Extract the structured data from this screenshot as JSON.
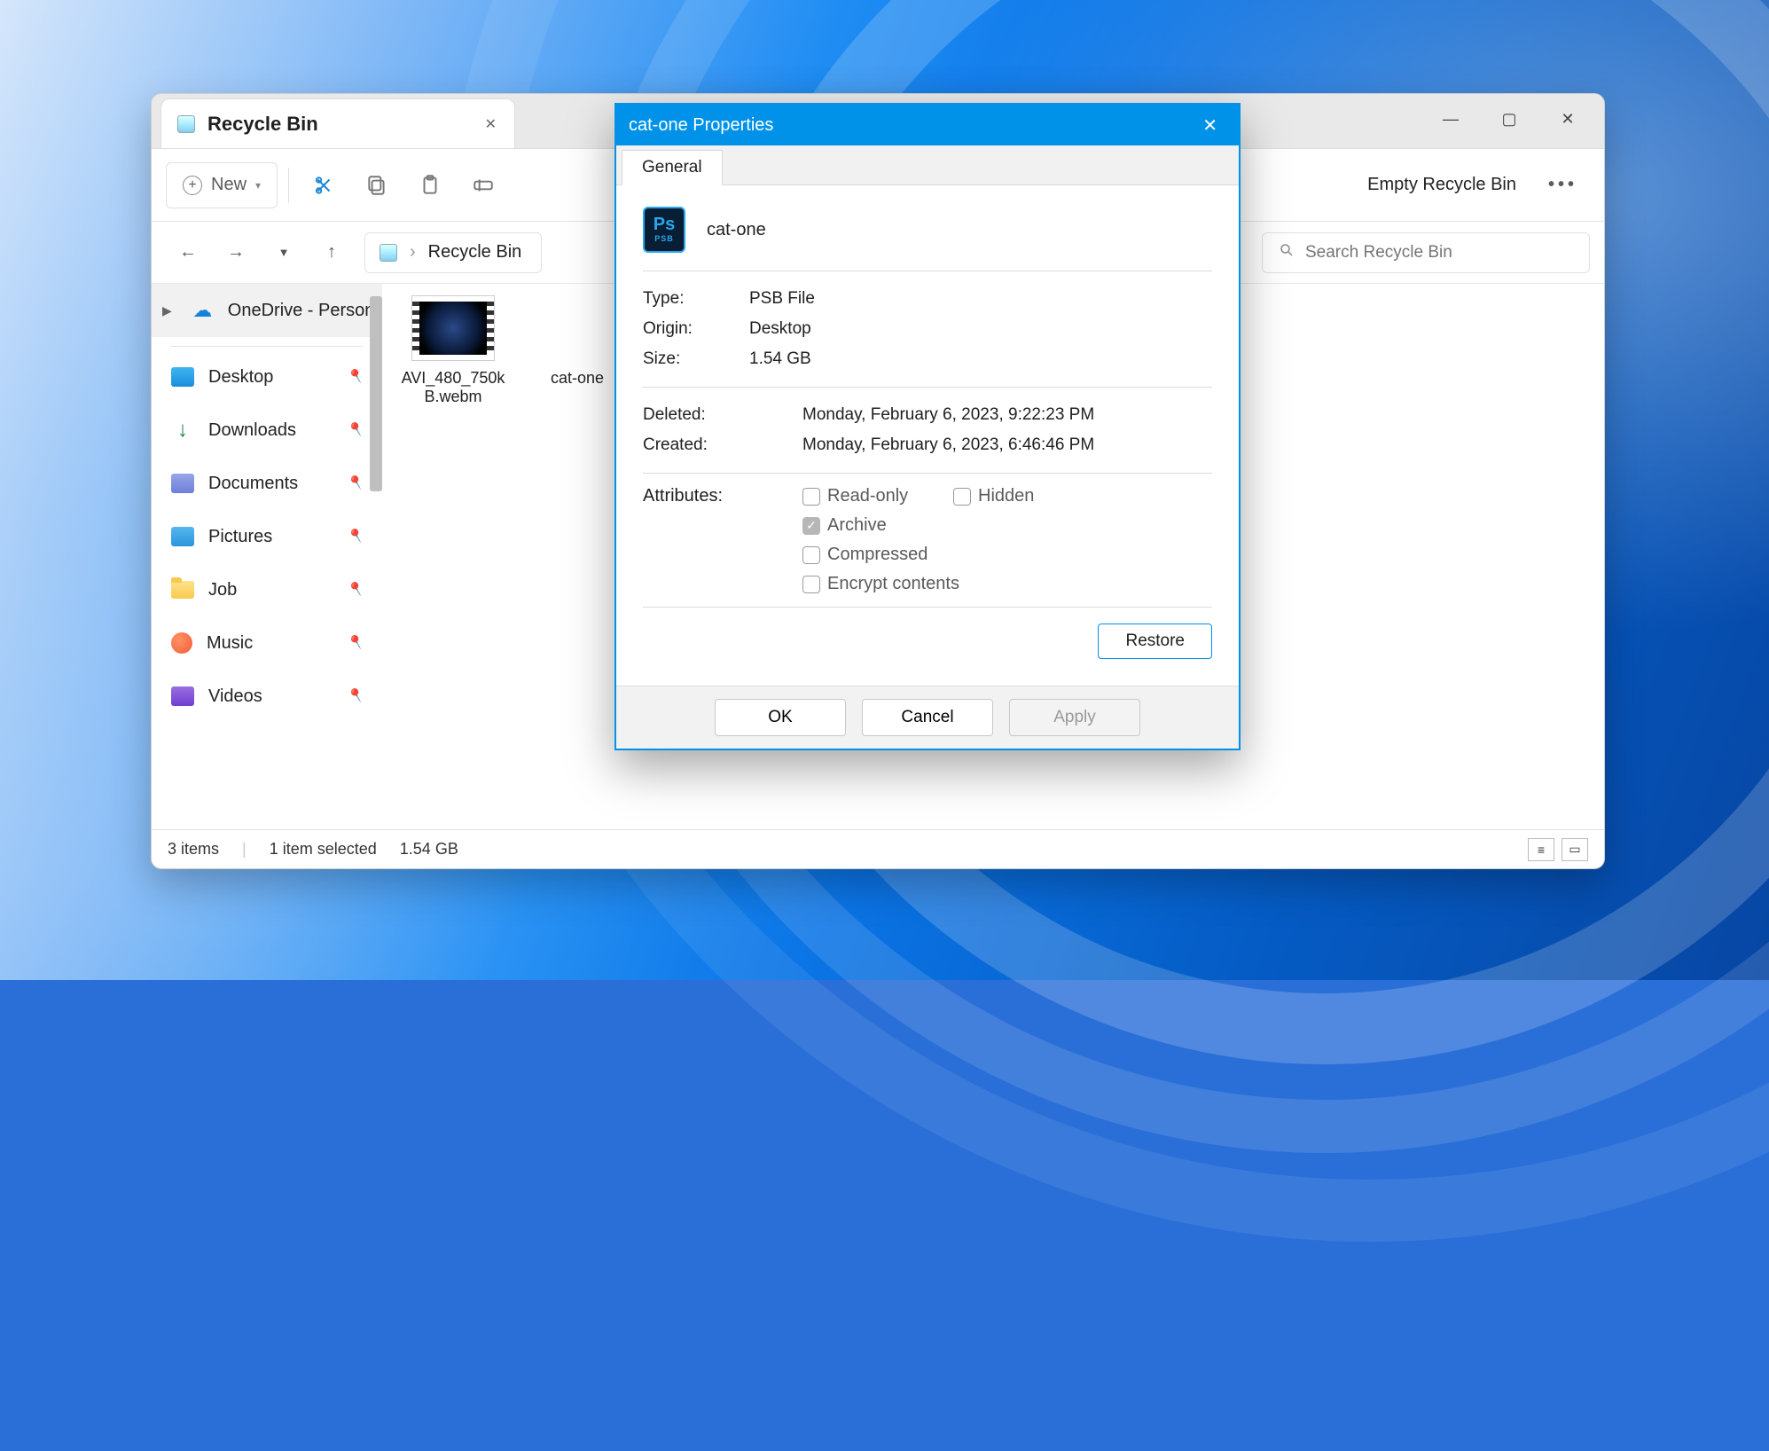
{
  "explorer": {
    "tab_title": "Recycle Bin",
    "toolbar": {
      "new_label": "New",
      "empty_label": "Empty Recycle Bin"
    },
    "breadcrumb": "Recycle Bin",
    "search_placeholder": "Search Recycle Bin",
    "sidebar": {
      "onedrive": "OneDrive - Personal",
      "items": [
        "Desktop",
        "Downloads",
        "Documents",
        "Pictures",
        "Job",
        "Music",
        "Videos"
      ]
    },
    "files": [
      {
        "name": "AVI_480_750kB.webm"
      },
      {
        "name": "cat-one"
      }
    ],
    "status": {
      "count": "3 items",
      "selected": "1 item selected",
      "size": "1.54 GB"
    }
  },
  "props": {
    "title": "cat-one Properties",
    "tab": "General",
    "filename": "cat-one",
    "icon_label_top": "Ps",
    "icon_label_bottom": "PSB",
    "rows1": {
      "type_label": "Type:",
      "type_value": "PSB File",
      "origin_label": "Origin:",
      "origin_value": "Desktop",
      "size_label": "Size:",
      "size_value": "1.54 GB"
    },
    "rows2": {
      "deleted_label": "Deleted:",
      "deleted_value": "Monday, February 6, 2023, 9:22:23 PM",
      "created_label": "Created:",
      "created_value": "Monday, February 6, 2023, 6:46:46 PM"
    },
    "attributes": {
      "label": "Attributes:",
      "readonly": "Read-only",
      "hidden": "Hidden",
      "archive": "Archive",
      "compressed": "Compressed",
      "encrypt": "Encrypt contents"
    },
    "buttons": {
      "restore": "Restore",
      "ok": "OK",
      "cancel": "Cancel",
      "apply": "Apply"
    }
  }
}
